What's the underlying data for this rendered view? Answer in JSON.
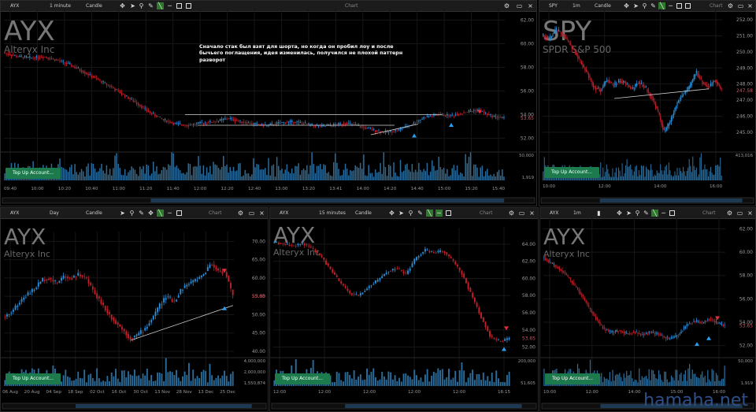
{
  "colors": {
    "up": "#2a8fd8",
    "down": "#c0202b",
    "bg": "#000000",
    "grid": "#161616",
    "axis_text": "#999999",
    "button": "#1c7a4c",
    "watermark": "#2f4f8a"
  },
  "watermark": "hamaha.net",
  "panels": [
    {
      "id": "main",
      "symbol": "AYX",
      "interval": "1 minute",
      "chart_type": "Candle",
      "chart_label": "Chart",
      "ticker_big": "AYX",
      "company": "Alteryx Inc",
      "note": [
        "Сначало стак был взят для шорта, но когда он пробил лоу  и после",
        "бычьего поглащения, идея изменилась, получился не плохой паттерн",
        "разворот"
      ],
      "button": "Top Up Account...",
      "price_axis": [
        "62.00",
        "60.00",
        "58.00",
        "56.00",
        "54.00",
        "52.00"
      ],
      "last_price": "53.65",
      "volume_axis": [
        "50,000",
        "1,919"
      ],
      "time_axis": [
        "09:40",
        "10:00",
        "10:20",
        "10:40",
        "11:00",
        "11:20",
        "11:40",
        "12:00",
        "12:20",
        "12:40",
        "13:00",
        "13:20",
        "13:41",
        "14:00",
        "14:20",
        "14:40",
        "15:00",
        "15:20",
        "15:40"
      ]
    },
    {
      "id": "spy",
      "symbol": "SPY",
      "interval": "1m",
      "chart_type": "Candle",
      "chart_label": "Chart",
      "ticker_big": "SPY",
      "company": "SPDR S&P 500",
      "button": "Top Up Account...",
      "price_axis": [
        "252.00",
        "251.00",
        "250.00",
        "249.00",
        "248.00",
        "247.00",
        "246.00",
        "245.00"
      ],
      "last_price": "247.58",
      "volume_axis": [
        "413,016"
      ],
      "time_axis": [
        "10:00",
        "12:00",
        "14:00",
        "16:00"
      ]
    },
    {
      "id": "daily",
      "symbol": "AYX",
      "interval": "Day",
      "chart_type": "Candle",
      "chart_label": "Chart",
      "ticker_big": "AYX",
      "company": "Alteryx Inc",
      "button": "Top Up Account...",
      "price_axis": [
        "70.00",
        "65.00",
        "60.00",
        "55.00",
        "50.00",
        "45.00",
        "40.00"
      ],
      "last_price": "53.65",
      "volume_axis": [
        "4,000,000",
        "2,000,000",
        "1,550,874"
      ],
      "time_axis": [
        "06 Aug",
        "20 Aug",
        "04 Sep",
        "18 Sep",
        "02 Oct",
        "16 Oct",
        "30 Oct",
        "13 Nov",
        "28 Nov",
        "13 Dec",
        "25 Dec"
      ]
    },
    {
      "id": "m15",
      "symbol": "AYX",
      "interval": "15 minutes",
      "chart_type": "Candle",
      "chart_label": "Chart",
      "ticker_big": "AYX",
      "company": "Alteryx Inc",
      "button": "Top Up Account...",
      "price_axis": [
        "64.00",
        "62.00",
        "60.00",
        "58.00",
        "56.00",
        "54.00",
        "52.00"
      ],
      "last_price": "53.65",
      "volume_axis": [
        "200,000",
        "51,605"
      ],
      "time_axis": [
        "12:00",
        "12:00",
        "12:00",
        "12:00",
        "12:00",
        "16:15"
      ]
    },
    {
      "id": "m1b",
      "symbol": "AYX",
      "interval": "1m",
      "chart_type": "Candle",
      "chart_label": "Chart",
      "ticker_big": "AYX",
      "company": "Alteryx Inc",
      "button": "Top Up Account...",
      "price_axis": [
        "62.00",
        "60.00",
        "58.00",
        "56.00",
        "54.00",
        "52.00"
      ],
      "last_price": "53.65",
      "volume_axis": [
        "50,000",
        "1,919"
      ],
      "time_axis": [
        "10:00",
        "12:00",
        "14:00",
        "15:00",
        "16:00"
      ]
    }
  ]
}
